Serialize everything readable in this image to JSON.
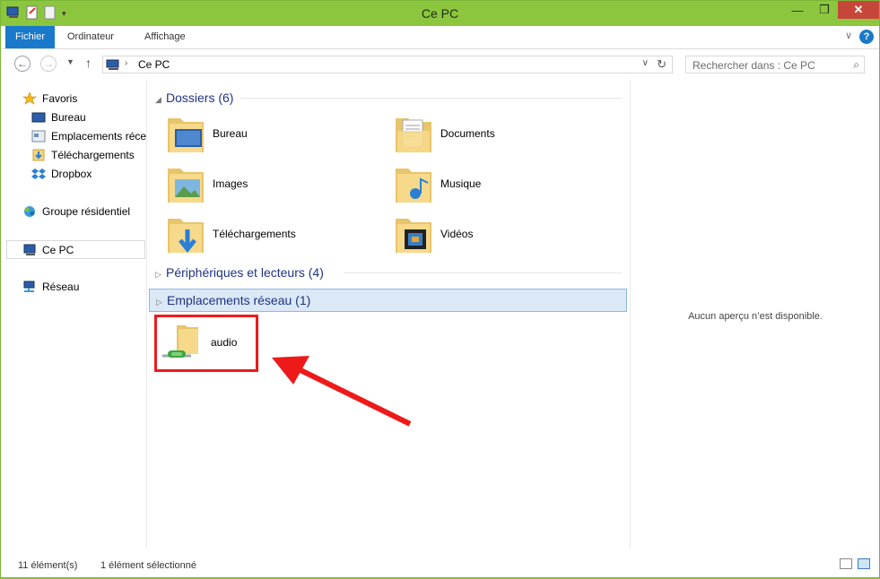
{
  "window": {
    "title": "Ce PC"
  },
  "ribbon": {
    "tabs": [
      "Fichier",
      "Ordinateur",
      "Affichage"
    ],
    "help": "?"
  },
  "address": {
    "crumb": "Ce PC",
    "search_placeholder": "Rechercher dans : Ce PC"
  },
  "nav": {
    "favorites": "Favoris",
    "favorites_items": [
      "Bureau",
      "Emplacements récents",
      "Téléchargements",
      "Dropbox"
    ],
    "homegroup": "Groupe résidentiel",
    "this_pc": "Ce PC",
    "network": "Réseau"
  },
  "groups": {
    "folders": "Dossiers (6)",
    "devices": "Périphériques et lecteurs (4)",
    "network": "Emplacements réseau (1)"
  },
  "folders": [
    "Bureau",
    "Documents",
    "Images",
    "Musique",
    "Téléchargements",
    "Vidéos"
  ],
  "network_items": [
    "audio"
  ],
  "preview": {
    "message": "Aucun aperçu n’est disponible."
  },
  "status": {
    "count": "11 élément(s)",
    "selected": "1 élément sélectionné"
  },
  "colors": {
    "titlebar": "#8cc63f",
    "file_tab": "#1979ca",
    "group_header": "#1e3287",
    "annotation": "#ee1a1a"
  }
}
